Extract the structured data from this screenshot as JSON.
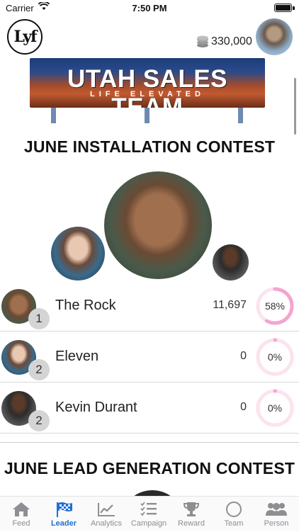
{
  "status_bar": {
    "carrier": "Carrier",
    "time": "7:50 PM"
  },
  "header": {
    "logo_text": "Lyf",
    "coins": "330,000"
  },
  "banner": {
    "title": "UTAH SALES TEAM",
    "subtitle": "LIFE ELEVATED"
  },
  "contest_1": {
    "title": "JUNE INSTALLATION CONTEST",
    "rows": [
      {
        "rank": "1",
        "name": "The Rock",
        "score": "11,697",
        "percent_label": "58%",
        "percent": 0.58
      },
      {
        "rank": "2",
        "name": "Eleven",
        "score": "0",
        "percent_label": "0%",
        "percent": 0.0
      },
      {
        "rank": "2",
        "name": "Kevin Durant",
        "score": "0",
        "percent_label": "0%",
        "percent": 0.0
      }
    ]
  },
  "contest_2": {
    "title": "JUNE LEAD GENERATION CONTEST"
  },
  "tabbar": {
    "tabs": [
      {
        "label": "Feed",
        "icon": "home-icon"
      },
      {
        "label": "Leader",
        "icon": "checkered-flag-icon",
        "active": true
      },
      {
        "label": "Analytics",
        "icon": "line-chart-icon"
      },
      {
        "label": "Campaign",
        "icon": "checklist-icon"
      },
      {
        "label": "Reward",
        "icon": "trophy-icon"
      },
      {
        "label": "Team",
        "icon": "circle-icon"
      },
      {
        "label": "Person",
        "icon": "people-icon"
      }
    ]
  },
  "colors": {
    "accent": "#1f6fd6",
    "ring": "#f3a6cf",
    "ring_track": "#fbe3ef"
  }
}
